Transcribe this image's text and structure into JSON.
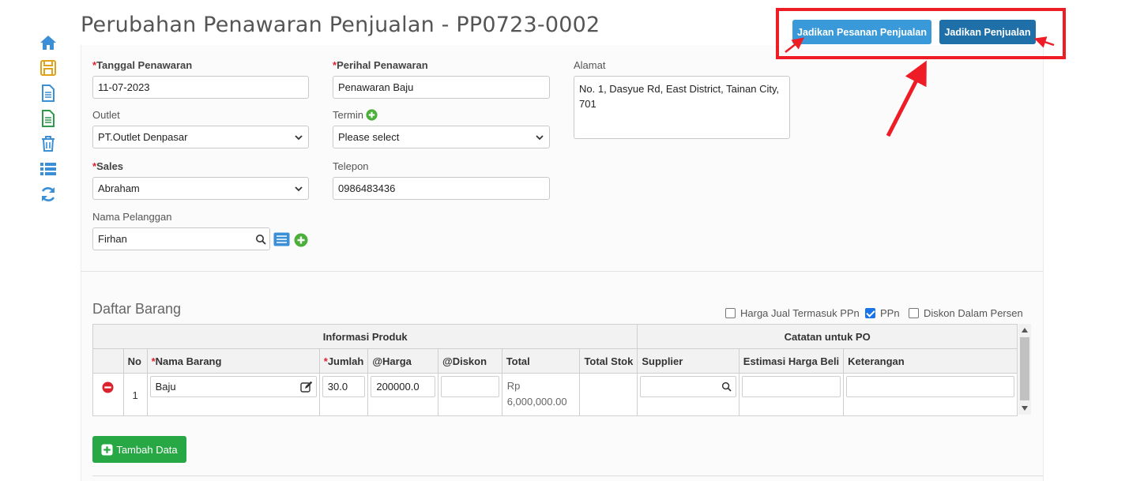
{
  "page": {
    "title": "Perubahan Penawaran Penjualan - PP0723-0002"
  },
  "toolbar": {
    "items": [
      {
        "icon": "home-icon",
        "color": "#3a8fd6"
      },
      {
        "icon": "save-icon",
        "color": "#e0a21a"
      },
      {
        "icon": "document-icon",
        "color": "#3a8fd6"
      },
      {
        "icon": "document-green-icon",
        "color": "#2e9a4a"
      },
      {
        "icon": "trash-icon",
        "color": "#3a8fd6"
      },
      {
        "icon": "list-icon",
        "color": "#3a8fd6"
      },
      {
        "icon": "refresh-icon",
        "color": "#3a8fd6"
      }
    ]
  },
  "actions": {
    "pesanan_label": "Jadikan Pesanan Penjualan",
    "penjualan_label": "Jadikan Penjualan",
    "highlight_color": "#ee1c25"
  },
  "form": {
    "required_mark": "*",
    "tanggal": {
      "label": "Tanggal Penawaran",
      "value": "11-07-2023"
    },
    "outlet": {
      "label": "Outlet",
      "value": "PT.Outlet Denpasar"
    },
    "sales": {
      "label": "Sales",
      "value": "Abraham"
    },
    "pelanggan": {
      "label": "Nama Pelanggan",
      "value": "Firhan"
    },
    "perihal": {
      "label": "Perihal Penawaran",
      "value": "Penawaran Baju"
    },
    "termin": {
      "label": "Termin",
      "value": "Please select"
    },
    "telepon": {
      "label": "Telepon",
      "value": "0986483436"
    },
    "alamat": {
      "label": "Alamat",
      "value": "No. 1, Dasyue Rd, East District, Tainan City, 701"
    }
  },
  "items_section": {
    "title": "Daftar Barang",
    "options": {
      "harga_ppn": {
        "label": "Harga Jual Termasuk PPn",
        "checked": false
      },
      "ppn": {
        "label": "PPn",
        "checked": true
      },
      "diskon_persen": {
        "label": "Diskon Dalam Persen",
        "checked": false
      }
    },
    "group_info": "Informasi Produk",
    "group_po": "Catatan untuk PO",
    "columns": {
      "no": "No",
      "nama": "Nama Barang",
      "jumlah": "Jumlah",
      "harga": "@Harga",
      "diskon": "@Diskon",
      "total": "Total",
      "stok": "Total Stok",
      "supplier": "Supplier",
      "estimasi": "Estimasi Harga Beli",
      "keterangan": "Keterangan"
    },
    "rows": [
      {
        "no": "1",
        "nama": "Baju",
        "jumlah": "30.0",
        "harga": "200000.0",
        "diskon": "",
        "total_currency": "Rp",
        "total_amount": "6,000,000.00",
        "stok": "",
        "supplier": "",
        "estimasi": "",
        "keterangan": ""
      }
    ],
    "add_label": "Tambah Data"
  }
}
